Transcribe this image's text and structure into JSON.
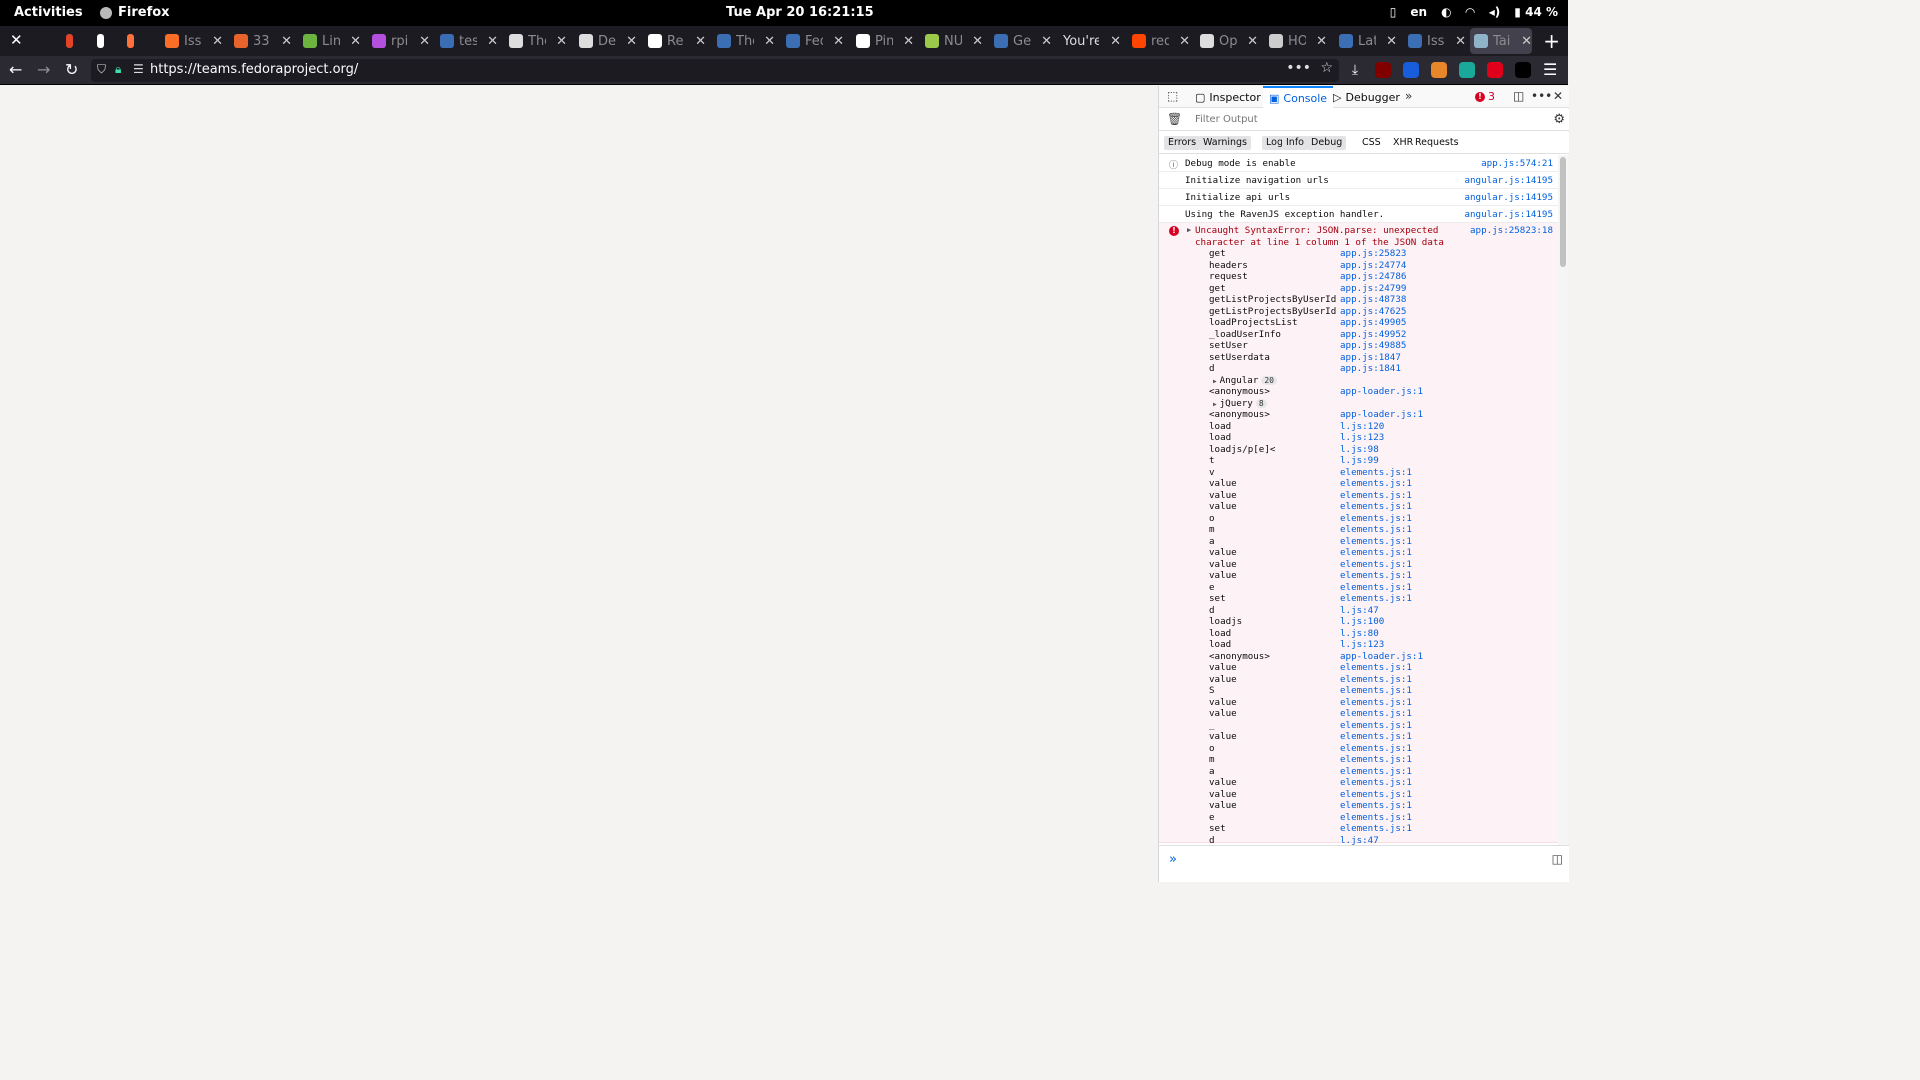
{
  "topbar": {
    "activities": "Activities",
    "app_name": "Firefox",
    "clock": "Tue Apr 20  16:21:15",
    "lang": "en",
    "battery": "44 %"
  },
  "tabs": [
    {
      "title": "",
      "color": "#e24329"
    },
    {
      "title": "",
      "color": "#ffffff"
    },
    {
      "title": "",
      "color": "#ff7139"
    },
    {
      "title": "Issu",
      "color": "#fc6d26"
    },
    {
      "title": "33",
      "color": "#e8622b"
    },
    {
      "title": "Lin",
      "color": "#6cb33f"
    },
    {
      "title": "rpi",
      "color": "#b44fde"
    },
    {
      "title": "tes",
      "color": "#3b6db4"
    },
    {
      "title": "The",
      "color": "#dddddd"
    },
    {
      "title": "De",
      "color": "#dddddd"
    },
    {
      "title": "Re",
      "color": "#ffffff"
    },
    {
      "title": "The",
      "color": "#3c6eb4"
    },
    {
      "title": "Fed",
      "color": "#3c6eb4"
    },
    {
      "title": "Pin",
      "color": "#ffffff"
    },
    {
      "title": "NU",
      "color": "#9bc94a"
    },
    {
      "title": "Ge",
      "color": "#3c6eb4"
    },
    {
      "title": "You're",
      "color": ""
    },
    {
      "title": "red",
      "color": "#ff4500"
    },
    {
      "title": "Op",
      "color": "#dddddd"
    },
    {
      "title": "HO",
      "color": "#cccccc"
    },
    {
      "title": "Lat",
      "color": "#3c6eb4"
    },
    {
      "title": "Iss",
      "color": "#3c6eb4"
    },
    {
      "title": "Tai",
      "color": "#8fb3c9"
    }
  ],
  "navbar": {
    "url": "https://teams.fedoraproject.org/"
  },
  "extensions": [
    {
      "name": "download-icon",
      "color": "#2b2a33"
    },
    {
      "name": "ublock-icon",
      "color": "#800000"
    },
    {
      "name": "bitwarden-icon",
      "color": "#175ddc"
    },
    {
      "name": "ext-orange-icon",
      "color": "#e8862a"
    },
    {
      "name": "ext-s-icon",
      "color": "#1aa89a"
    },
    {
      "name": "ext-red-icon",
      "color": "#e1001a"
    },
    {
      "name": "ext-dark-icon",
      "color": "#000000"
    }
  ],
  "devtools": {
    "tabs": {
      "inspector": "Inspector",
      "console": "Console",
      "debugger": "Debugger"
    },
    "error_count": "3",
    "filter_placeholder": "Filter Output",
    "levels": [
      "Errors",
      "Warnings",
      "Logs",
      "Info",
      "Debug"
    ],
    "types": [
      "CSS",
      "XHR",
      "Requests"
    ],
    "messages": [
      {
        "text": "Debug mode is enable",
        "source": "app.js:574:21",
        "info": true
      },
      {
        "text": "Initialize navigation urls",
        "source": "angular.js:14195",
        "info": false
      },
      {
        "text": "Initialize api urls",
        "source": "angular.js:14195",
        "info": false
      },
      {
        "text": "Using the RavenJS exception handler.",
        "source": "angular.js:14195",
        "info": false
      }
    ],
    "error": {
      "message": "Uncaught SyntaxError: JSON.parse: unexpected character at line 1 column 1 of the JSON data",
      "source": "app.js:25823:18",
      "frames": [
        {
          "fn": "get",
          "loc": "app.js:25823"
        },
        {
          "fn": "headers",
          "loc": "app.js:24774"
        },
        {
          "fn": "request",
          "loc": "app.js:24786"
        },
        {
          "fn": "get",
          "loc": "app.js:24799"
        },
        {
          "fn": "getListProjectsByUserId",
          "loc": "app.js:48738"
        },
        {
          "fn": "getListProjectsByUserId",
          "loc": "app.js:47625"
        },
        {
          "fn": "loadProjectsList",
          "loc": "app.js:49905"
        },
        {
          "fn": "_loadUserInfo",
          "loc": "app.js:49952"
        },
        {
          "fn": "setUser",
          "loc": "app.js:49885"
        },
        {
          "fn": "setUserdata",
          "loc": "app.js:1847"
        },
        {
          "fn": "d",
          "loc": "app.js:1841"
        },
        {
          "group": "Angular",
          "count": "20"
        },
        {
          "fn": "<anonymous>",
          "loc": "app-loader.js:1"
        },
        {
          "group": "jQuery",
          "count": "8"
        },
        {
          "fn": "<anonymous>",
          "loc": "app-loader.js:1"
        },
        {
          "fn": "load",
          "loc": "l.js:120"
        },
        {
          "fn": "load",
          "loc": "l.js:123"
        },
        {
          "fn": "loadjs/p[e]<",
          "loc": "l.js:98"
        },
        {
          "fn": "t",
          "loc": "l.js:99"
        },
        {
          "fn": "v",
          "loc": "elements.js:1"
        },
        {
          "fn": "value",
          "loc": "elements.js:1"
        },
        {
          "fn": "value",
          "loc": "elements.js:1"
        },
        {
          "fn": "value",
          "loc": "elements.js:1"
        },
        {
          "fn": "o",
          "loc": "elements.js:1"
        },
        {
          "fn": "m",
          "loc": "elements.js:1"
        },
        {
          "fn": "a",
          "loc": "elements.js:1"
        },
        {
          "fn": "value",
          "loc": "elements.js:1"
        },
        {
          "fn": "value",
          "loc": "elements.js:1"
        },
        {
          "fn": "value",
          "loc": "elements.js:1"
        },
        {
          "fn": "e",
          "loc": "elements.js:1"
        },
        {
          "fn": "set",
          "loc": "elements.js:1"
        },
        {
          "fn": "d",
          "loc": "l.js:47"
        },
        {
          "fn": "loadjs",
          "loc": "l.js:100"
        },
        {
          "fn": "load",
          "loc": "l.js:80"
        },
        {
          "fn": "load",
          "loc": "l.js:123"
        },
        {
          "fn": "<anonymous>",
          "loc": "app-loader.js:1"
        },
        {
          "fn": "value",
          "loc": "elements.js:1"
        },
        {
          "fn": "value",
          "loc": "elements.js:1"
        },
        {
          "fn": "S",
          "loc": "elements.js:1"
        },
        {
          "fn": "value",
          "loc": "elements.js:1"
        },
        {
          "fn": "value",
          "loc": "elements.js:1"
        },
        {
          "fn": "_",
          "loc": "elements.js:1"
        },
        {
          "fn": "value",
          "loc": "elements.js:1"
        },
        {
          "fn": "o",
          "loc": "elements.js:1"
        },
        {
          "fn": "m",
          "loc": "elements.js:1"
        },
        {
          "fn": "a",
          "loc": "elements.js:1"
        },
        {
          "fn": "value",
          "loc": "elements.js:1"
        },
        {
          "fn": "value",
          "loc": "elements.js:1"
        },
        {
          "fn": "value",
          "loc": "elements.js:1"
        },
        {
          "fn": "e",
          "loc": "elements.js:1"
        },
        {
          "fn": "set",
          "loc": "elements.js:1"
        },
        {
          "fn": "d",
          "loc": "l.js:47"
        }
      ]
    }
  }
}
